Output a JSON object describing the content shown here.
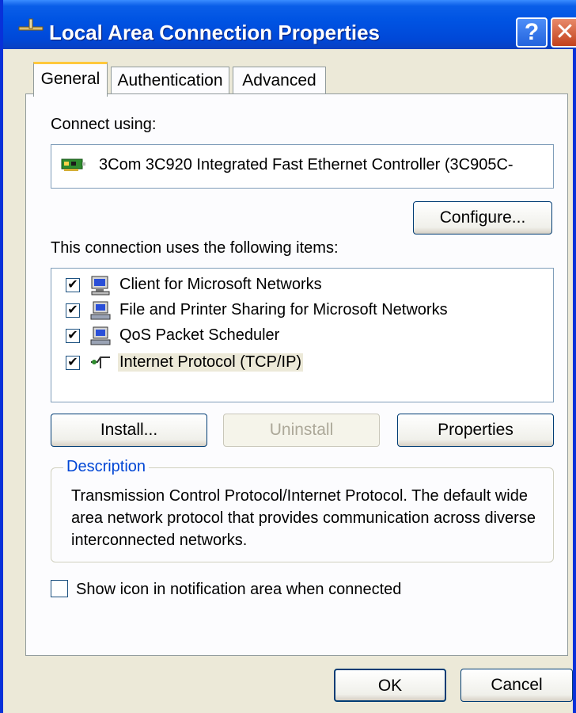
{
  "window": {
    "title": "Local Area Connection Properties",
    "help_label": "?",
    "close_label": "✕"
  },
  "tabs": [
    {
      "label": "General",
      "active": true
    },
    {
      "label": "Authentication",
      "active": false
    },
    {
      "label": "Advanced",
      "active": false
    }
  ],
  "general": {
    "connect_using_label": "Connect using:",
    "device_name": "3Com 3C920 Integrated Fast Ethernet Controller (3C905C-",
    "configure_label": "Configure...",
    "items_label": "This connection uses the following items:",
    "items": [
      {
        "label": "Client for Microsoft Networks",
        "checked": true,
        "icon": "network-client-icon"
      },
      {
        "label": "File and Printer Sharing for Microsoft Networks",
        "checked": true,
        "icon": "network-service-icon"
      },
      {
        "label": "QoS Packet Scheduler",
        "checked": true,
        "icon": "network-service-icon"
      },
      {
        "label": "Internet Protocol (TCP/IP)",
        "checked": true,
        "icon": "protocol-icon",
        "selected": true
      }
    ],
    "install_label": "Install...",
    "uninstall_label": "Uninstall",
    "properties_label": "Properties",
    "description_title": "Description",
    "description_text": "Transmission Control Protocol/Internet Protocol. The default wide area network protocol that provides communication across diverse interconnected networks.",
    "notify_label": "Show icon in notification area when connected",
    "notify_checked": false
  },
  "footer": {
    "ok_label": "OK",
    "cancel_label": "Cancel"
  },
  "colors": {
    "titlebar": "#0054e3",
    "dialog_bg": "#ece9d8",
    "accent_tab": "#ffc83c",
    "group_title": "#0046d5"
  }
}
